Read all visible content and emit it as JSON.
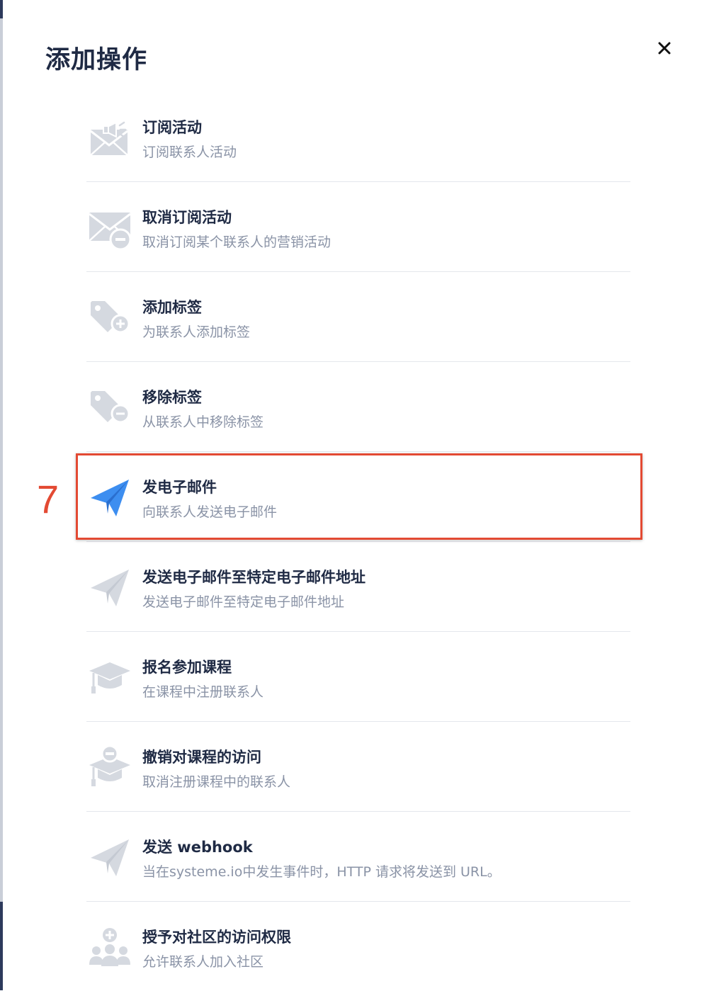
{
  "modal": {
    "title": "添加操作",
    "close_icon": "close-icon",
    "annotation": {
      "step_number": "7",
      "color": "#e34a33"
    }
  },
  "colors": {
    "title": "#1f2a44",
    "muted_icon": "#d5d9e0",
    "accent_icon": "#3d8ef0",
    "description": "#8a93a6"
  },
  "actions": [
    {
      "icon": "megaphone-envelope-icon",
      "name": "订阅活动",
      "description": "订阅联系人活动"
    },
    {
      "icon": "envelope-minus-icon",
      "name": "取消订阅活动",
      "description": "取消订阅某个联系人的营销活动"
    },
    {
      "icon": "tag-plus-icon",
      "name": "添加标签",
      "description": "为联系人添加标签"
    },
    {
      "icon": "tag-minus-icon",
      "name": "移除标签",
      "description": "从联系人中移除标签"
    },
    {
      "icon": "paper-plane-icon",
      "name": "发电子邮件",
      "description": "向联系人发送电子邮件",
      "highlighted": true
    },
    {
      "icon": "paper-plane-icon",
      "name": "发送电子邮件至特定电子邮件地址",
      "description": "发送电子邮件至特定电子邮件地址"
    },
    {
      "icon": "graduation-cap-icon",
      "name": "报名参加课程",
      "description": "在课程中注册联系人"
    },
    {
      "icon": "graduation-cap-minus-icon",
      "name": "撤销对课程的访问",
      "description": "取消注册课程中的联系人"
    },
    {
      "icon": "paper-plane-icon",
      "name": "发送 webhook",
      "description": "当在systeme.io中发生事件时，HTTP 请求将发送到 URL。"
    },
    {
      "icon": "community-plus-icon",
      "name": "授予对社区的访问权限",
      "description": "允许联系人加入社区"
    }
  ]
}
